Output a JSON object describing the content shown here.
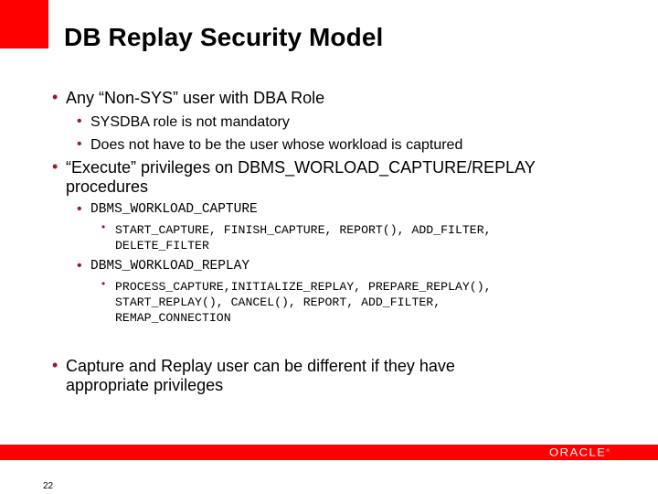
{
  "slide": {
    "title": "DB Replay Security Model",
    "page_number": "22",
    "brand_color": "#ff0000",
    "bullet_color": "#a0142c",
    "logo_text": "ORACLE",
    "logo_mark": "®"
  },
  "bullets": [
    {
      "text": "Any “Non-SYS” user with DBA Role",
      "children": [
        "SYSDBA role is not mandatory",
        "Does not have to be the user whose workload is captured"
      ]
    },
    {
      "text_line1": "“Execute” privileges on DBMS_WORLOAD_CAPTURE/REPLAY",
      "text_line2": "procedures",
      "children": [
        {
          "text": "DBMS_WORKLOAD_CAPTURE",
          "children": [
            {
              "line1": "START_CAPTURE, FINISH_CAPTURE, REPORT(), ADD_FILTER,",
              "line2": "DELETE_FILTER"
            }
          ]
        },
        {
          "text": "DBMS_WORKLOAD_REPLAY",
          "children": [
            {
              "line1": "PROCESS_CAPTURE,INITIALIZE_REPLAY, PREPARE_REPLAY(),",
              "line2": "START_REPLAY(), CANCEL(), REPORT, ADD_FILTER,",
              "line3": "REMAP_CONNECTION"
            }
          ]
        }
      ]
    },
    {
      "text_line1": "Capture and Replay user can be different if they have",
      "text_line2": "appropriate privileges"
    }
  ],
  "icons": {
    "bullet": "•"
  }
}
